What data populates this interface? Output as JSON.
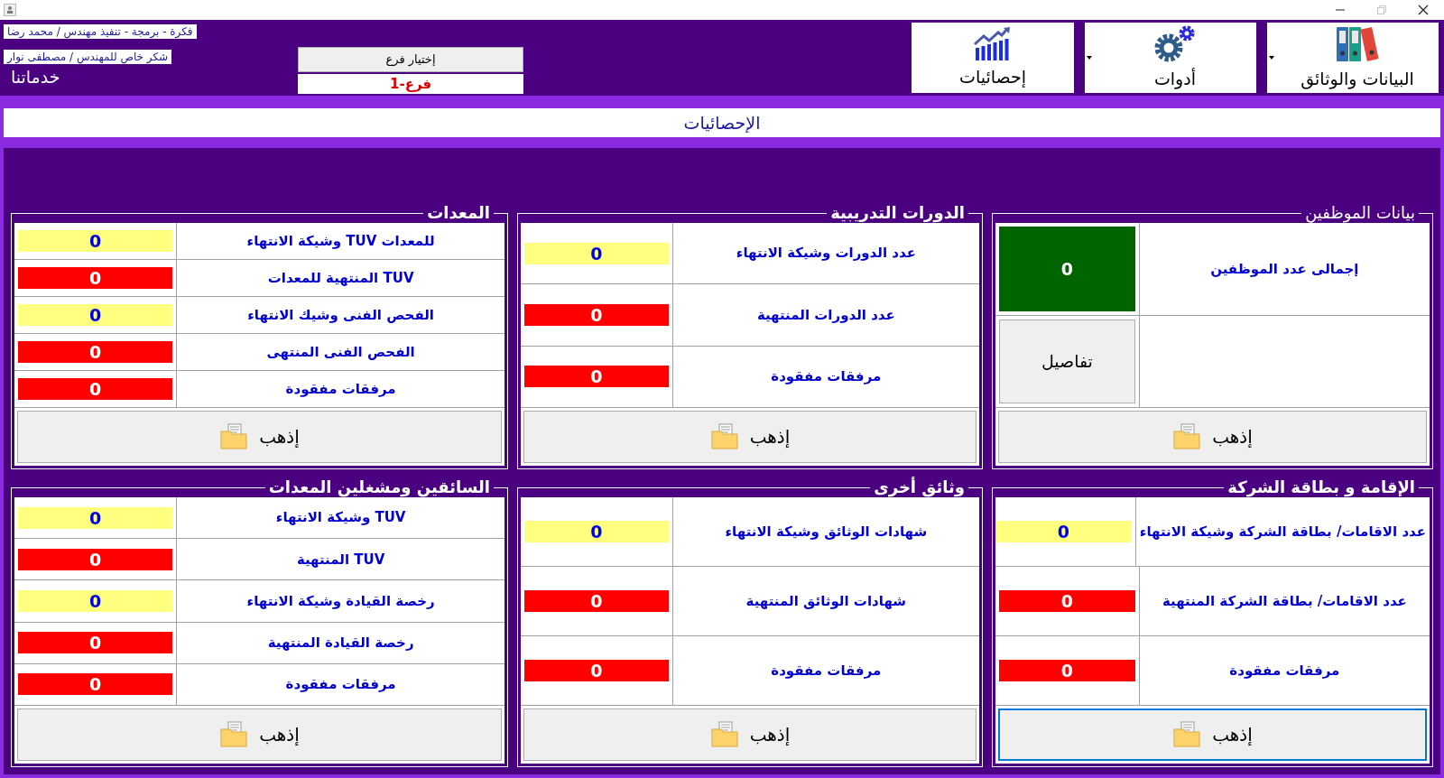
{
  "window": {
    "controls": [
      {
        "kind": "minimize",
        "disabled": false
      },
      {
        "kind": "maximize",
        "disabled": true
      },
      {
        "kind": "close",
        "disabled": false
      }
    ]
  },
  "header": {
    "credits": [
      "فكرة - برمجة  - تنفيذ مهندس /  محمد رضا",
      "شكر خاص للمهندس / مصطفى نوار"
    ],
    "services_label": "خدماتنا",
    "branch_button": "إختيار فرع",
    "branch_value": "فرع-1",
    "toolbar": [
      {
        "label": "البيانات والوثائق",
        "kind": "binders",
        "dropdown": true
      },
      {
        "label": "أدوات",
        "kind": "gears",
        "dropdown": true
      },
      {
        "label": "إحصائيات",
        "kind": "chart",
        "dropdown": false
      }
    ]
  },
  "page_title": "الإحصائيات",
  "panels": [
    {
      "title": "بيانات الموظفين",
      "bold_title": false,
      "rows": [
        {
          "kind": "total",
          "label": "إجمالى عدد الموظفين",
          "value": "0"
        },
        {
          "kind": "button",
          "label": "تفاصيل"
        }
      ],
      "go": {
        "label": "إذهب",
        "focused": false
      }
    },
    {
      "title": "الدورات التدريبية",
      "bold_title": true,
      "rows": [
        {
          "kind": "warning",
          "label": "عدد الدورات وشيكة الانتهاء",
          "value": "0"
        },
        {
          "kind": "expired",
          "label": "عدد الدورات المنتهية",
          "value": "0"
        },
        {
          "kind": "expired",
          "label": "مرفقات مفقودة",
          "value": "0"
        }
      ],
      "go": {
        "label": "إذهب",
        "focused": false
      }
    },
    {
      "title": "المعدات",
      "bold_title": true,
      "rows": [
        {
          "kind": "warning",
          "label": "للمعدات TUV وشيكة الانتهاء",
          "value": "0"
        },
        {
          "kind": "expired",
          "label": "TUV المنتهية للمعدات",
          "value": "0"
        },
        {
          "kind": "warning",
          "label": "الفحص الفنى وشيك الانتهاء",
          "value": "0"
        },
        {
          "kind": "expired",
          "label": "الفحص الفنى المنتهى",
          "value": "0"
        },
        {
          "kind": "expired",
          "label": "مرفقات مفقودة",
          "value": "0"
        }
      ],
      "go": {
        "label": "إذهب",
        "focused": false
      }
    },
    {
      "title": "الإقامة و بطاقة الشركة",
      "bold_title": true,
      "rows": [
        {
          "kind": "warning",
          "label": "عدد الاقامات/ بطاقة الشركة وشيكة الانتهاء",
          "value": "0"
        },
        {
          "kind": "expired",
          "label": "عدد الاقامات/ بطاقة الشركة المنتهية",
          "value": "0"
        },
        {
          "kind": "expired",
          "label": "مرفقات مفقودة",
          "value": "0"
        }
      ],
      "go": {
        "label": "إذهب",
        "focused": true
      }
    },
    {
      "title": "وثائق أخرى",
      "bold_title": true,
      "rows": [
        {
          "kind": "warning",
          "label": "شهادات الوثائق وشيكة الانتهاء",
          "value": "0"
        },
        {
          "kind": "expired",
          "label": "شهادات الوثائق المنتهية",
          "value": "0"
        },
        {
          "kind": "expired",
          "label": "مرفقات مفقودة",
          "value": "0"
        }
      ],
      "go": {
        "label": "إذهب",
        "focused": false
      }
    },
    {
      "title": "السائقين ومشغلين المعدات",
      "bold_title": true,
      "rows": [
        {
          "kind": "warning",
          "label": "TUV وشيكة الانتهاء",
          "value": "0"
        },
        {
          "kind": "expired",
          "label": "TUV المنتهية",
          "value": "0"
        },
        {
          "kind": "warning",
          "label": "رخصة القيادة وشيكة الانتهاء",
          "value": "0"
        },
        {
          "kind": "expired",
          "label": "رخصة القيادة المنتهية",
          "value": "0"
        },
        {
          "kind": "expired",
          "label": "مرفقات مفقودة",
          "value": "0"
        }
      ],
      "go": {
        "label": "إذهب",
        "focused": false
      }
    }
  ]
}
